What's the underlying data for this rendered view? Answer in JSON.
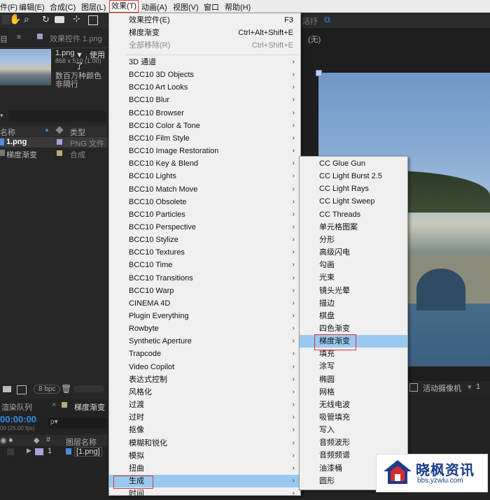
{
  "menubar": {
    "items": [
      "件(F)",
      "编辑(E)",
      "合成(C)",
      "图层(L)",
      "效果(T)",
      "动画(A)",
      "视图(V)",
      "窗口",
      "帮助(H)"
    ],
    "active_index": 4
  },
  "left_panel": {
    "tab_project": "目",
    "tab_effects": "效果控件 1.png",
    "footage": {
      "name": "1.png",
      "name_suffix": "▼ , 使用了",
      "dims": "868 x 510 (1.00)",
      "colors": "数百万种颜色",
      "alpha": "非隔行"
    },
    "search_placeholder": "",
    "columns": {
      "name": "名称",
      "type": "类型"
    },
    "rows": [
      {
        "name": "1.png",
        "type": "PNG 文件"
      },
      {
        "name": "梯度渐变",
        "type": "合成"
      }
    ],
    "bpc": "8 bpc"
  },
  "bottom_left": {
    "tab_render": "渲染队列",
    "tab_comp": "梯度渐变",
    "timecode": "00:00:00",
    "fps": "00 (25.00 fps)",
    "search_placeholder": "ρ▾",
    "layer_header": "图层名称",
    "layer_num": "1",
    "layer_name": "[1.png]"
  },
  "viewer": {
    "label_hangout": "活抒",
    "label_none": "(无)",
    "camera": "活动摄像机",
    "view_count": "1"
  },
  "effects_menu": {
    "top": [
      {
        "label": "效果控件(E)",
        "shortcut": "F3",
        "disabled": false
      },
      {
        "label": "梯度渐变",
        "shortcut": "Ctrl+Alt+Shift+E",
        "disabled": false
      },
      {
        "label": "全部移除(R)",
        "shortcut": "Ctrl+Shift+E",
        "disabled": true
      }
    ],
    "items": [
      "3D 通道",
      "BCC10 3D Objects",
      "BCC10 Art Looks",
      "BCC10 Blur",
      "BCC10 Browser",
      "BCC10 Color & Tone",
      "BCC10 Film Style",
      "BCC10 Image Restoration",
      "BCC10 Key & Blend",
      "BCC10 Lights",
      "BCC10 Match Move",
      "BCC10 Obsolete",
      "BCC10 Particles",
      "BCC10 Perspective",
      "BCC10 Stylize",
      "BCC10 Textures",
      "BCC10 Time",
      "BCC10 Transitions",
      "BCC10 Warp",
      "CINEMA 4D",
      "Plugin Everything",
      "Rowbyte",
      "Synthetic Aperture",
      "Trapcode",
      "Video Copilot",
      "表达式控制",
      "风格化",
      "过渡",
      "过时",
      "抠像",
      "模糊和锐化",
      "模拟",
      "扭曲",
      "生成",
      "时间"
    ],
    "highlighted_index": 33
  },
  "generate_submenu": {
    "items": [
      "CC Glue Gun",
      "CC Light Burst 2.5",
      "CC Light Rays",
      "CC Light Sweep",
      "CC Threads",
      "单元格图案",
      "分形",
      "高级闪电",
      "勾画",
      "光束",
      "镜头光晕",
      "描边",
      "棋盘",
      "四色渐变",
      "梯度渐变",
      "填充",
      "涂写",
      "椭圆",
      "网格",
      "无线电波",
      "吸管填充",
      "写入",
      "音频波形",
      "音频频谱",
      "油漆桶",
      "圆形"
    ],
    "highlighted_index": 14
  },
  "watermark": {
    "title": "晓枫资讯",
    "url": "bbs.yzwlu.com"
  },
  "colors": {
    "highlight": "#99c9ef",
    "accent_red": "#dd3333",
    "menu_bg": "#f0f0f0",
    "panel_bg": "#232323",
    "timecode_blue": "#2f8be6"
  }
}
